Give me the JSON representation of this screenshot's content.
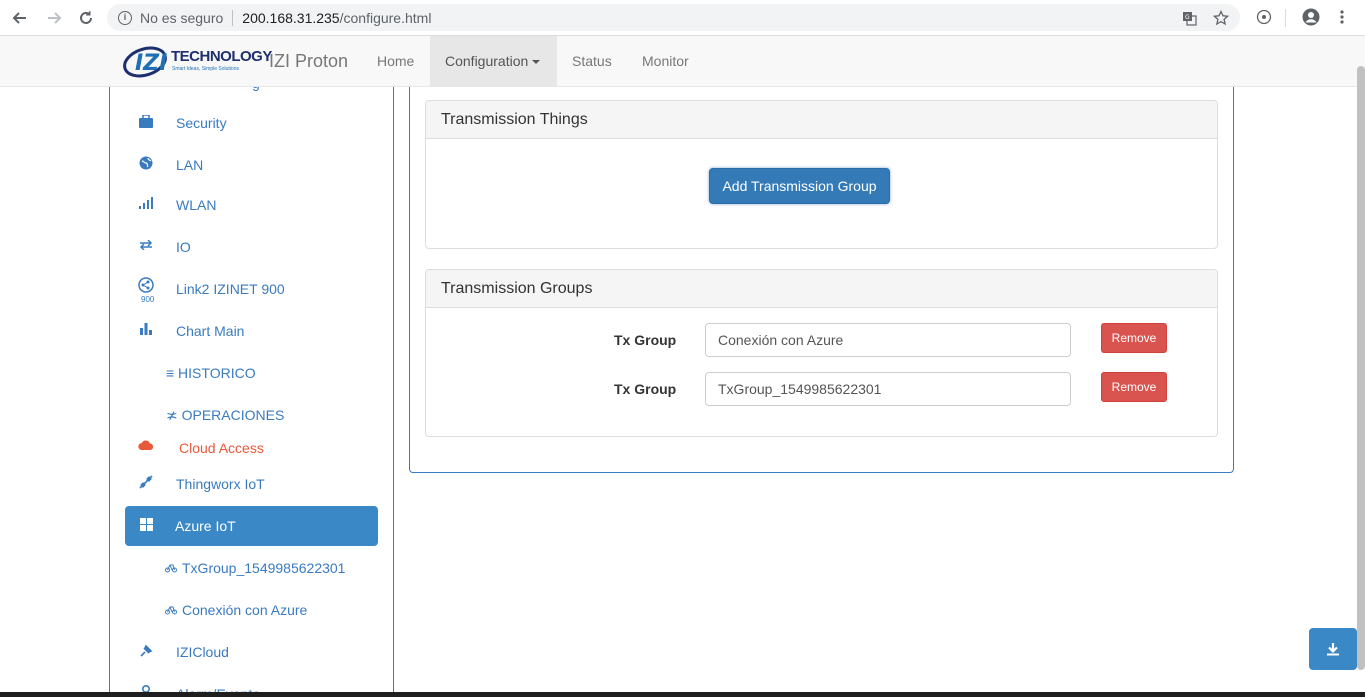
{
  "browser": {
    "security_label": "No es seguro",
    "url_host": "200.168.31.235",
    "url_path": "/configure.html"
  },
  "navbar": {
    "logo_word": "TECHNOLOGY",
    "logo_tagline": "Smart Ideas, Simple Solutions",
    "brand": "IZI Proton",
    "links": [
      "Home",
      "Configuration",
      "Status",
      "Monitor"
    ],
    "active_link": "Configuration"
  },
  "sidebar": {
    "items": [
      {
        "label": "Security",
        "icon": "briefcase-icon"
      },
      {
        "label": "LAN",
        "icon": "globe-icon"
      },
      {
        "label": "WLAN",
        "icon": "signal-icon"
      },
      {
        "label": "IO",
        "icon": "transfer-icon"
      },
      {
        "label": "Link2 IZINET 900",
        "icon": "share-900-icon",
        "icon_caption": "900"
      },
      {
        "label": "Chart Main",
        "icon": "bar-chart-icon"
      },
      {
        "label": "≡ HISTORICO",
        "icon": ""
      },
      {
        "label": "≭ OPERACIONES",
        "icon": ""
      },
      {
        "label": "Cloud Access",
        "icon": "cloud-icon"
      },
      {
        "label": "Thingworx IoT",
        "icon": "satellite-icon"
      },
      {
        "label": "Azure IoT",
        "icon": "windows-icon"
      },
      {
        "label": "TxGroup_1549985622301",
        "icon": "bicycle-icon"
      },
      {
        "label": "Conexión con Azure",
        "icon": "bicycle-icon"
      },
      {
        "label": "IZICloud",
        "icon": "pin-icon"
      },
      {
        "label": "Alarm/Evento",
        "icon": "user-icon"
      }
    ],
    "active_item": "Azure IoT"
  },
  "main": {
    "things_panel": {
      "title": "Transmission Things",
      "add_button": "Add Transmission Group"
    },
    "groups_panel": {
      "title": "Transmission Groups",
      "rows": [
        {
          "label": "Tx Group",
          "value": "Conexión con Azure",
          "remove": "Remove"
        },
        {
          "label": "Tx Group",
          "value": "TxGroup_1549985622301",
          "remove": "Remove"
        }
      ]
    }
  },
  "colors": {
    "primary": "#337ab7",
    "sidebar_active": "#3a88c6",
    "danger": "#d9534f",
    "cloud_access": "#e8593a",
    "sidebar_text": "#3a7bbf"
  }
}
